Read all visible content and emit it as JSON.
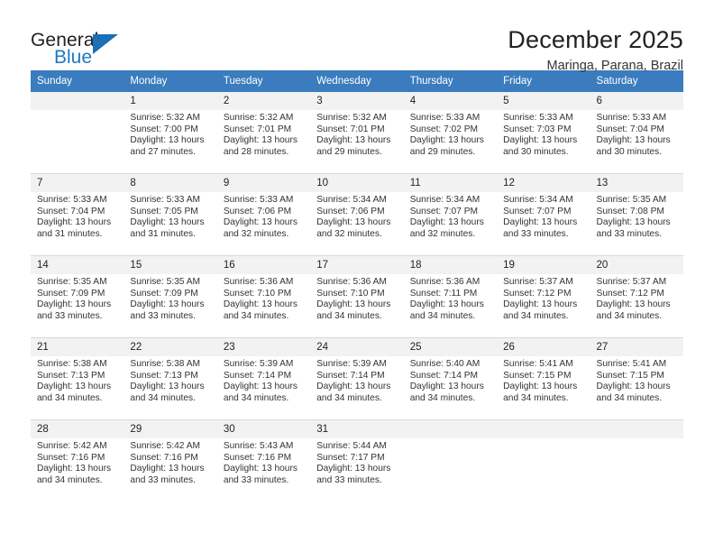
{
  "brand": {
    "name_part1": "General",
    "name_part2": "Blue",
    "triangle_color": "#1a6fb5",
    "blue_color": "#1f78c1"
  },
  "header": {
    "title": "December 2025",
    "subtitle": "Maringa, Parana, Brazil"
  },
  "theme": {
    "header_row_bg": "#3a7cbe",
    "daynum_bg": "#f2f2f2",
    "grid_line": "#d9d9d9"
  },
  "weekdays": [
    "Sunday",
    "Monday",
    "Tuesday",
    "Wednesday",
    "Thursday",
    "Friday",
    "Saturday"
  ],
  "weeks": [
    [
      {
        "day": "",
        "sunrise": "",
        "sunset": "",
        "daylight_line1": "",
        "daylight_line2": ""
      },
      {
        "day": "1",
        "sunrise": "Sunrise: 5:32 AM",
        "sunset": "Sunset: 7:00 PM",
        "daylight_line1": "Daylight: 13 hours",
        "daylight_line2": "and 27 minutes."
      },
      {
        "day": "2",
        "sunrise": "Sunrise: 5:32 AM",
        "sunset": "Sunset: 7:01 PM",
        "daylight_line1": "Daylight: 13 hours",
        "daylight_line2": "and 28 minutes."
      },
      {
        "day": "3",
        "sunrise": "Sunrise: 5:32 AM",
        "sunset": "Sunset: 7:01 PM",
        "daylight_line1": "Daylight: 13 hours",
        "daylight_line2": "and 29 minutes."
      },
      {
        "day": "4",
        "sunrise": "Sunrise: 5:33 AM",
        "sunset": "Sunset: 7:02 PM",
        "daylight_line1": "Daylight: 13 hours",
        "daylight_line2": "and 29 minutes."
      },
      {
        "day": "5",
        "sunrise": "Sunrise: 5:33 AM",
        "sunset": "Sunset: 7:03 PM",
        "daylight_line1": "Daylight: 13 hours",
        "daylight_line2": "and 30 minutes."
      },
      {
        "day": "6",
        "sunrise": "Sunrise: 5:33 AM",
        "sunset": "Sunset: 7:04 PM",
        "daylight_line1": "Daylight: 13 hours",
        "daylight_line2": "and 30 minutes."
      }
    ],
    [
      {
        "day": "7",
        "sunrise": "Sunrise: 5:33 AM",
        "sunset": "Sunset: 7:04 PM",
        "daylight_line1": "Daylight: 13 hours",
        "daylight_line2": "and 31 minutes."
      },
      {
        "day": "8",
        "sunrise": "Sunrise: 5:33 AM",
        "sunset": "Sunset: 7:05 PM",
        "daylight_line1": "Daylight: 13 hours",
        "daylight_line2": "and 31 minutes."
      },
      {
        "day": "9",
        "sunrise": "Sunrise: 5:33 AM",
        "sunset": "Sunset: 7:06 PM",
        "daylight_line1": "Daylight: 13 hours",
        "daylight_line2": "and 32 minutes."
      },
      {
        "day": "10",
        "sunrise": "Sunrise: 5:34 AM",
        "sunset": "Sunset: 7:06 PM",
        "daylight_line1": "Daylight: 13 hours",
        "daylight_line2": "and 32 minutes."
      },
      {
        "day": "11",
        "sunrise": "Sunrise: 5:34 AM",
        "sunset": "Sunset: 7:07 PM",
        "daylight_line1": "Daylight: 13 hours",
        "daylight_line2": "and 32 minutes."
      },
      {
        "day": "12",
        "sunrise": "Sunrise: 5:34 AM",
        "sunset": "Sunset: 7:07 PM",
        "daylight_line1": "Daylight: 13 hours",
        "daylight_line2": "and 33 minutes."
      },
      {
        "day": "13",
        "sunrise": "Sunrise: 5:35 AM",
        "sunset": "Sunset: 7:08 PM",
        "daylight_line1": "Daylight: 13 hours",
        "daylight_line2": "and 33 minutes."
      }
    ],
    [
      {
        "day": "14",
        "sunrise": "Sunrise: 5:35 AM",
        "sunset": "Sunset: 7:09 PM",
        "daylight_line1": "Daylight: 13 hours",
        "daylight_line2": "and 33 minutes."
      },
      {
        "day": "15",
        "sunrise": "Sunrise: 5:35 AM",
        "sunset": "Sunset: 7:09 PM",
        "daylight_line1": "Daylight: 13 hours",
        "daylight_line2": "and 33 minutes."
      },
      {
        "day": "16",
        "sunrise": "Sunrise: 5:36 AM",
        "sunset": "Sunset: 7:10 PM",
        "daylight_line1": "Daylight: 13 hours",
        "daylight_line2": "and 34 minutes."
      },
      {
        "day": "17",
        "sunrise": "Sunrise: 5:36 AM",
        "sunset": "Sunset: 7:10 PM",
        "daylight_line1": "Daylight: 13 hours",
        "daylight_line2": "and 34 minutes."
      },
      {
        "day": "18",
        "sunrise": "Sunrise: 5:36 AM",
        "sunset": "Sunset: 7:11 PM",
        "daylight_line1": "Daylight: 13 hours",
        "daylight_line2": "and 34 minutes."
      },
      {
        "day": "19",
        "sunrise": "Sunrise: 5:37 AM",
        "sunset": "Sunset: 7:12 PM",
        "daylight_line1": "Daylight: 13 hours",
        "daylight_line2": "and 34 minutes."
      },
      {
        "day": "20",
        "sunrise": "Sunrise: 5:37 AM",
        "sunset": "Sunset: 7:12 PM",
        "daylight_line1": "Daylight: 13 hours",
        "daylight_line2": "and 34 minutes."
      }
    ],
    [
      {
        "day": "21",
        "sunrise": "Sunrise: 5:38 AM",
        "sunset": "Sunset: 7:13 PM",
        "daylight_line1": "Daylight: 13 hours",
        "daylight_line2": "and 34 minutes."
      },
      {
        "day": "22",
        "sunrise": "Sunrise: 5:38 AM",
        "sunset": "Sunset: 7:13 PM",
        "daylight_line1": "Daylight: 13 hours",
        "daylight_line2": "and 34 minutes."
      },
      {
        "day": "23",
        "sunrise": "Sunrise: 5:39 AM",
        "sunset": "Sunset: 7:14 PM",
        "daylight_line1": "Daylight: 13 hours",
        "daylight_line2": "and 34 minutes."
      },
      {
        "day": "24",
        "sunrise": "Sunrise: 5:39 AM",
        "sunset": "Sunset: 7:14 PM",
        "daylight_line1": "Daylight: 13 hours",
        "daylight_line2": "and 34 minutes."
      },
      {
        "day": "25",
        "sunrise": "Sunrise: 5:40 AM",
        "sunset": "Sunset: 7:14 PM",
        "daylight_line1": "Daylight: 13 hours",
        "daylight_line2": "and 34 minutes."
      },
      {
        "day": "26",
        "sunrise": "Sunrise: 5:41 AM",
        "sunset": "Sunset: 7:15 PM",
        "daylight_line1": "Daylight: 13 hours",
        "daylight_line2": "and 34 minutes."
      },
      {
        "day": "27",
        "sunrise": "Sunrise: 5:41 AM",
        "sunset": "Sunset: 7:15 PM",
        "daylight_line1": "Daylight: 13 hours",
        "daylight_line2": "and 34 minutes."
      }
    ],
    [
      {
        "day": "28",
        "sunrise": "Sunrise: 5:42 AM",
        "sunset": "Sunset: 7:16 PM",
        "daylight_line1": "Daylight: 13 hours",
        "daylight_line2": "and 34 minutes."
      },
      {
        "day": "29",
        "sunrise": "Sunrise: 5:42 AM",
        "sunset": "Sunset: 7:16 PM",
        "daylight_line1": "Daylight: 13 hours",
        "daylight_line2": "and 33 minutes."
      },
      {
        "day": "30",
        "sunrise": "Sunrise: 5:43 AM",
        "sunset": "Sunset: 7:16 PM",
        "daylight_line1": "Daylight: 13 hours",
        "daylight_line2": "and 33 minutes."
      },
      {
        "day": "31",
        "sunrise": "Sunrise: 5:44 AM",
        "sunset": "Sunset: 7:17 PM",
        "daylight_line1": "Daylight: 13 hours",
        "daylight_line2": "and 33 minutes."
      },
      {
        "day": "",
        "sunrise": "",
        "sunset": "",
        "daylight_line1": "",
        "daylight_line2": ""
      },
      {
        "day": "",
        "sunrise": "",
        "sunset": "",
        "daylight_line1": "",
        "daylight_line2": ""
      },
      {
        "day": "",
        "sunrise": "",
        "sunset": "",
        "daylight_line1": "",
        "daylight_line2": ""
      }
    ]
  ]
}
